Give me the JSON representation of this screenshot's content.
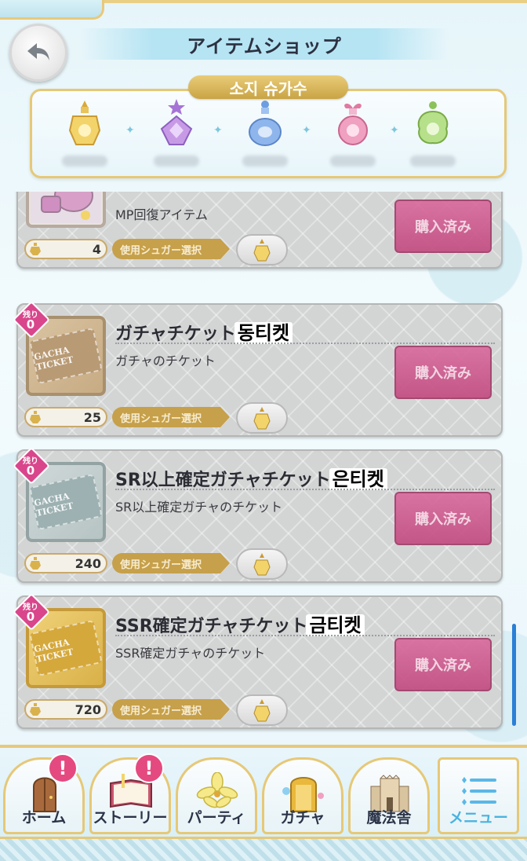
{
  "header": {
    "title": "アイテムショップ"
  },
  "sugars": {
    "label": "소지 슈가수",
    "items": [
      {
        "name": "yellow-sugar-bottle",
        "color": "#f2d46a"
      },
      {
        "name": "purple-sugar-bottle",
        "color": "#c79ae6"
      },
      {
        "name": "blue-sugar-bottle",
        "color": "#8fb6ec"
      },
      {
        "name": "pink-sugar-bottle",
        "color": "#f0a0c0"
      },
      {
        "name": "green-sugar-bottle",
        "color": "#b6e08a"
      }
    ]
  },
  "items": [
    {
      "name": "",
      "desc": "MP回復アイテム",
      "buy": "購入済み",
      "price": "4",
      "select": "使用シュガー選択"
    },
    {
      "remain_label": "残り",
      "remain": "0",
      "name": "ガチャチケット",
      "kr": "동티켓",
      "desc": "ガチャのチケット",
      "buy": "購入済み",
      "price": "25",
      "select": "使用シュガー選択",
      "ticket": "GACHA TICKET"
    },
    {
      "remain_label": "残り",
      "remain": "0",
      "name": "SR以上確定ガチャチケット",
      "kr": "은티켓",
      "desc": "SR以上確定ガチャのチケット",
      "buy": "購入済み",
      "price": "240",
      "select": "使用シュガー選択",
      "ticket": "GACHA TICKET"
    },
    {
      "remain_label": "残り",
      "remain": "0",
      "name": "SSR確定ガチャチケット",
      "kr": "금티켓",
      "desc": "SSR確定ガチャのチケット",
      "buy": "購入済み",
      "price": "720",
      "select": "使用シュガー選択",
      "ticket": "GACHA TICKET"
    }
  ],
  "nav": {
    "home": "ホーム",
    "story": "ストーリー",
    "party": "パーティ",
    "gacha": "ガチャ",
    "magic": "魔法舎",
    "menu": "メニュー",
    "badge": "!"
  }
}
